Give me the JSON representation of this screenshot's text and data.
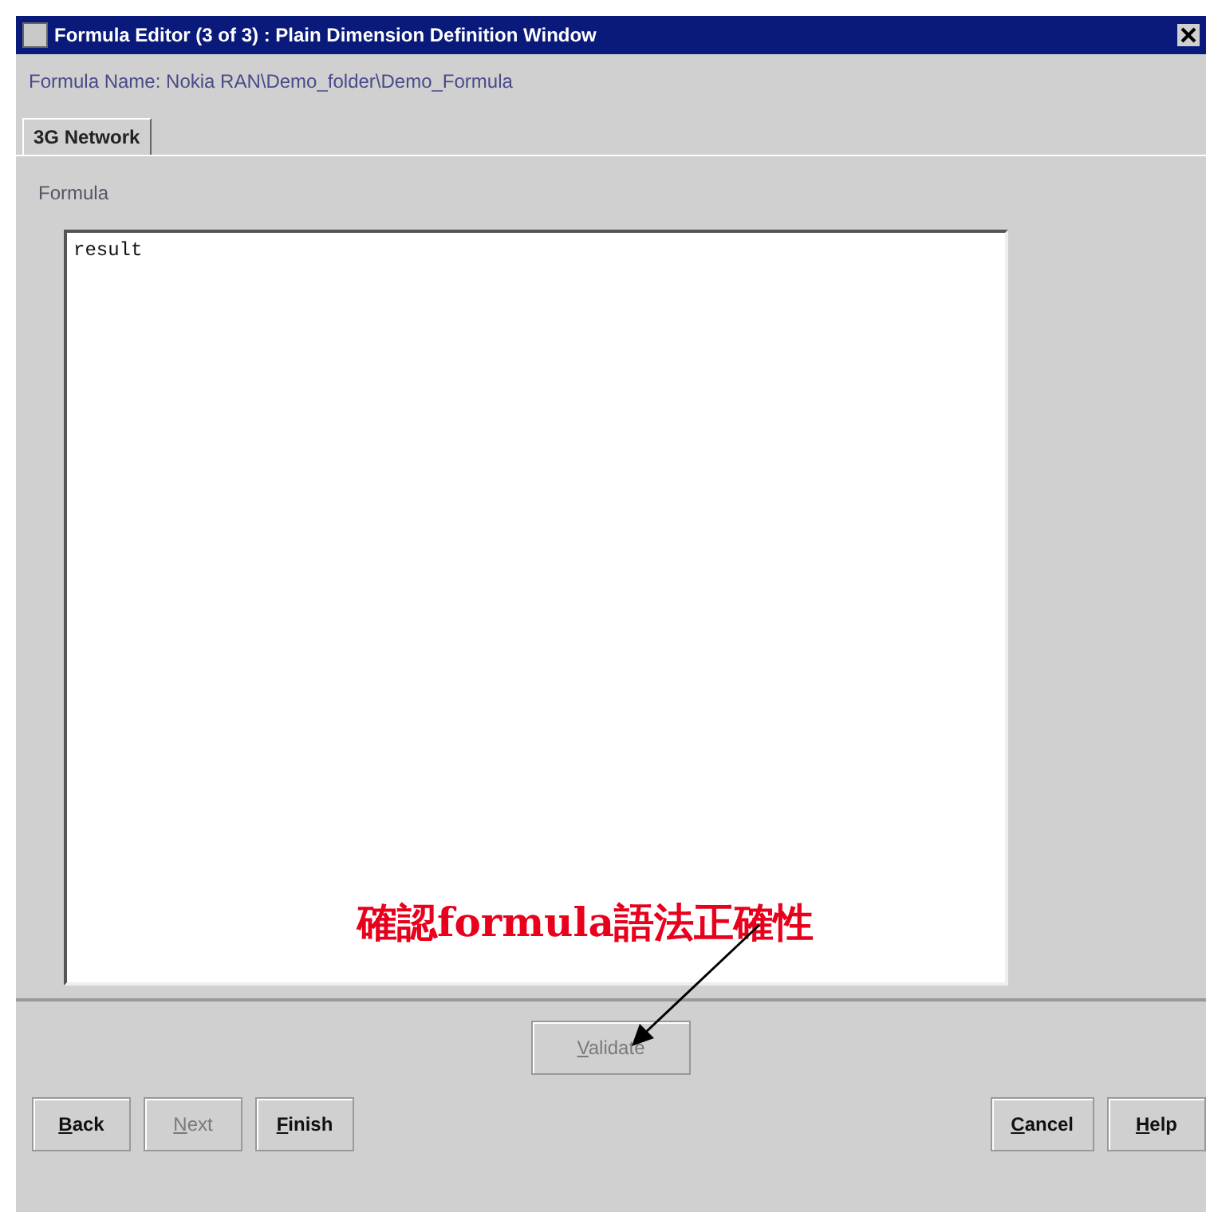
{
  "window": {
    "title": "Formula Editor (3 of 3) : Plain Dimension Definition Window"
  },
  "formula_name": "Formula Name: Nokia RAN\\Demo_folder\\Demo_Formula",
  "tabs": [
    {
      "label": "3G Network",
      "selected": true
    }
  ],
  "formula": {
    "label": "Formula",
    "value": "result"
  },
  "annotation": "確認formula語法正確性",
  "validate_button": {
    "label": "Validate",
    "disabled": true
  },
  "buttons_left": [
    {
      "label": "Back",
      "disabled": false
    },
    {
      "label": "Next",
      "disabled": true
    },
    {
      "label": "Finish",
      "disabled": false
    }
  ],
  "buttons_right": [
    {
      "label": "Cancel",
      "disabled": false
    },
    {
      "label": "Help",
      "disabled": false
    }
  ]
}
